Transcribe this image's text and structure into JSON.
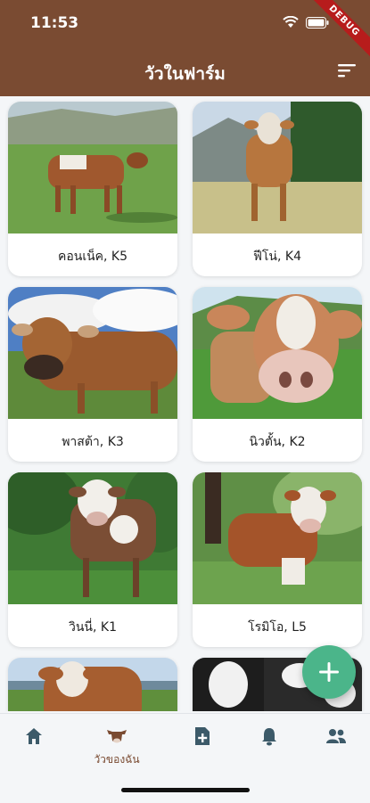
{
  "status_bar": {
    "time": "11:53",
    "debug_banner": "DEBUG"
  },
  "app_bar": {
    "title": "วัวในฟาร์ม",
    "action_icon": "sort-icon"
  },
  "colors": {
    "header": "#7a4b32",
    "fab": "#4bb58a",
    "nav_icon": "#3c5a69",
    "nav_active": "#7a4b32"
  },
  "cows": [
    {
      "label": "คอนเน็ค, K5"
    },
    {
      "label": "ฟีโน่, K4"
    },
    {
      "label": "พาสต้า, K3"
    },
    {
      "label": "นิวตั้น, K2"
    },
    {
      "label": "วินนี่, K1"
    },
    {
      "label": "โรมิโอ, L5"
    },
    {
      "label": ""
    },
    {
      "label": ""
    }
  ],
  "fab": {
    "icon": "plus-icon"
  },
  "bottom_nav": {
    "items": [
      {
        "icon": "home-icon",
        "label": ""
      },
      {
        "icon": "cow-icon",
        "label": "วัวของฉัน",
        "active": true
      },
      {
        "icon": "add-document-icon",
        "label": ""
      },
      {
        "icon": "bell-icon",
        "label": ""
      },
      {
        "icon": "people-icon",
        "label": ""
      }
    ]
  }
}
